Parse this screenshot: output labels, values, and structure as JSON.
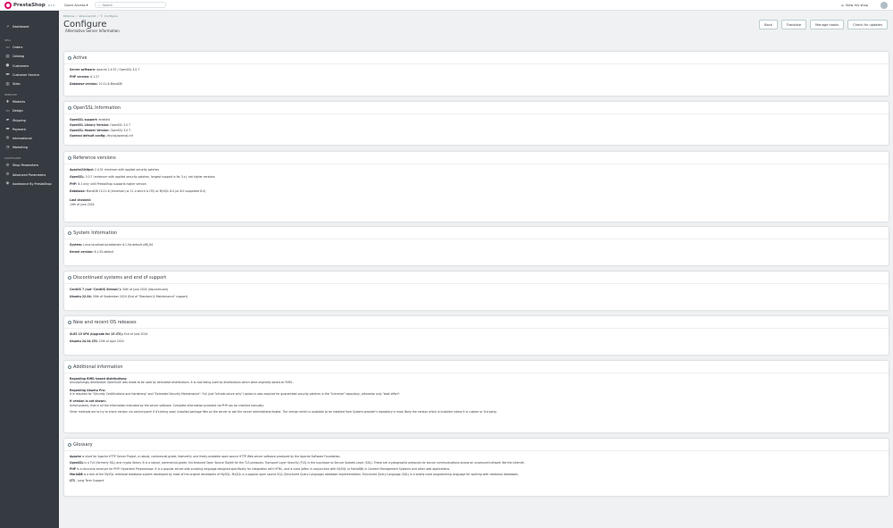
{
  "topbar": {
    "brand": "PrestaShop",
    "version": "8.1.6",
    "quick_access": "Quick Access",
    "search_placeholder": "Search",
    "view_shop": "View my shop"
  },
  "sidebar": {
    "dashboard": "Dashboard",
    "sell_heading": "SELL",
    "sell": [
      "Orders",
      "Catalog",
      "Customers",
      "Customer Service",
      "Stats"
    ],
    "improve_heading": "IMPROVE",
    "improve": [
      "Modules",
      "Design",
      "Shipping",
      "Payment",
      "International",
      "Marketing"
    ],
    "configure_heading": "CONFIGURE",
    "configure": [
      "Shop Parameters",
      "Advanced Parameters",
      "Assistance By PrestaShop"
    ]
  },
  "header": {
    "breadcrumb": [
      "Modules",
      "altserverinfo",
      "Configure"
    ],
    "title": "Configure",
    "subtitle": "Alternative Server Information",
    "buttons": [
      "Back",
      "Translate",
      "Manage hooks",
      "Check for updates"
    ]
  },
  "panels": {
    "active": {
      "title": "Active",
      "rows": [
        {
          "label": "Server software:",
          "value": " Apache 2.4.57 / OpenSSL 3.0.7"
        },
        {
          "label": "PHP version:",
          "value": " 8.1.27"
        },
        {
          "label": "Database version:",
          "value": " 10.11.6-MariaDB"
        }
      ]
    },
    "openssl": {
      "title": "OpenSSL Information",
      "rows": [
        {
          "label": "OpenSSL support:",
          "value": " enabled"
        },
        {
          "label": "OpenSSL Library Version:",
          "value": " OpenSSL 3.0.7"
        },
        {
          "label": "OpenSSL Header Version:",
          "value": " OpenSSL 3.0.7"
        },
        {
          "label": "Openssl default config:",
          "value": " /etc/ssl/openssl.cnf"
        }
      ]
    },
    "reference": {
      "title": "Reference versions",
      "rows": [
        {
          "label": "Apache2/httpd:",
          "value": " 2.4.51 minimum with applied security patches"
        },
        {
          "label": "OpenSSL:",
          "value": " 3.0.7 (minimum with applied security patches, longest support is for 3.x), not higher versions"
        },
        {
          "label": "PHP:",
          "value": " 8.1 only until PrestaShop supports higher version"
        },
        {
          "label": "Database:",
          "value": " MariaDB 10.11.6 (minimum) or 11.4 which is LTS) or MySQL 8.4 (or 8.0 supported 8.0)"
        }
      ],
      "last_checked_label": "Last checked:",
      "last_checked_value": "19th of June 2024"
    },
    "system": {
      "title": "System Information",
      "rows": [
        {
          "label": "System:",
          "value": " Linux localhost.localdomain 6.1.0d-default x86_64"
        },
        {
          "label": "Kernel version:",
          "value": " 6.1.55-default"
        }
      ]
    },
    "discontinued": {
      "title": "Discontinued systems and end of support",
      "rows": [
        {
          "label": "CentOS 7 (not \"CentOS Stream\"):",
          "value": " 30th of June 2024 (discontinued)"
        },
        {
          "label": "Ubuntu 22.04:",
          "value": " 30th of September 2024 (End of \"Standard & Maintenance\" support)"
        }
      ]
    },
    "new_os": {
      "title": "New and recent OS releases",
      "rows": [
        {
          "label": "SLES 15 SP6 (Upgrade for 15 LTS):",
          "value": " End of June 2024"
        },
        {
          "label": "Ubuntu 24.04 LTS:",
          "value": " 25th of April 2024"
        }
      ]
    },
    "additional": {
      "title": "Additional information",
      "blocks": [
        {
          "title": "Regarding RHEL-based distributions:",
          "text": "Unsurprisingly distribution OpenSuSE was made to be used by derivative distributions. It is now being used by distributions which were originally based on RHEL."
        },
        {
          "title": "Regarding Ubuntu Pro:",
          "text": "It is required for \"Security Certifications and Hardening\" and \"Extended Security Maintenance\". Full (not \"Infrastructure only\") option is also required for guaranteed security patches in the \"Universe\" repository, otherwise only \"best effort\"."
        },
        {
          "title": "If version is not shown:",
          "text": "Unfortunately, that is all the information indicated by the server software. Complete information provided via PHP can be checked manually."
        },
        {
          "title": "",
          "text": "Other methods are to try to check version via control panel if it's being used, installed package files on the server or ask the server administrator/hoster. The version which is available to be installed from System provider's repository is most likely the version which is installed unless it is custom or 3rd party."
        }
      ]
    },
    "glossary": {
      "title": "Glossary",
      "rows": [
        {
          "label": "Apache",
          "value": " is short for Apache HTTP Server Project, a robust, commercial-grade, featureful, and freely-available open source HTTP Web server software produced by the Apache Software Foundation."
        },
        {
          "label": "OpenSSL",
          "value": " is a TLS (formerly SSL) and crypto library. It is a robust, commercial-grade, full-featured Open Source Toolkit for the TLS protocols. Transport Layer Security (TLS) is the successor to Secure Sockets Layer (SSL). These are cryptographic protocols for secure communications across an unsecured network like the Internet."
        },
        {
          "label": "PHP",
          "value": " is a recursive acronym for PHP: Hypertext Preprocessor. It is a popular server-side scripting language designed specifically for integration with HTML, and is used (often in conjunction with MySQL or MariaDB) in Content Management Systems and other web applications."
        },
        {
          "label": "MariaDB",
          "value": " is a fork of the MySQL relational database system developed by most of the original developers of MySQL. MySQL is a popular open source SQL (Structured Query Language) database implementation. Structured Query Language (SQL) is a widely used programming language for working with relational databases."
        },
        {
          "label": "LTS",
          "value": " - Long Term Support."
        }
      ]
    }
  }
}
